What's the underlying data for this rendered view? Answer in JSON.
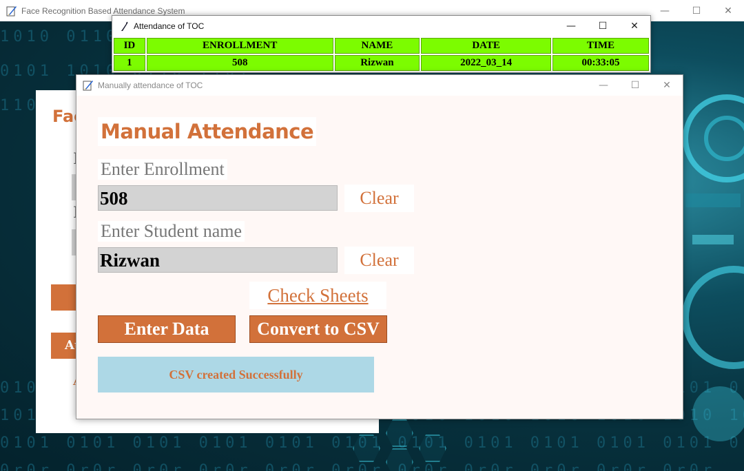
{
  "main_window": {
    "title": "Face Recognition Based Attendance System",
    "controls": {
      "minimize": "—",
      "maximize": "☐",
      "close": "✕"
    },
    "background_panel": {
      "title": "Fac",
      "partial_button": "Au",
      "partial_text": "A"
    }
  },
  "attendance_window": {
    "title": "Attendance of TOC",
    "controls": {
      "minimize": "—",
      "maximize": "☐",
      "close": "✕"
    },
    "table": {
      "headers": [
        "ID",
        "ENROLLMENT",
        "NAME",
        "DATE",
        "TIME"
      ],
      "rows": [
        [
          "1",
          "508",
          "Rizwan",
          "2022_03_14",
          "00:33:05"
        ]
      ]
    },
    "colors": {
      "cell_bg": "#7cfc00"
    }
  },
  "manual_window": {
    "title": "Manually attendance of TOC",
    "controls": {
      "minimize": "—",
      "maximize": "☐",
      "close": "✕"
    },
    "heading": "Manual Attendance",
    "enrollment_label": "Enter Enrollment",
    "enrollment_value": "508",
    "name_label": "Enter Student name",
    "name_value": "Rizwan",
    "clear_label": "Clear",
    "check_sheets_label": "Check Sheets",
    "enter_data_label": "Enter Data",
    "convert_label": "Convert to CSV",
    "status_message": "CSV created Successfully",
    "colors": {
      "accent": "#d2713a",
      "entry_bg": "#d3d3d3",
      "status_bg": "#add8e6",
      "window_bg": "#fff8f6"
    }
  }
}
